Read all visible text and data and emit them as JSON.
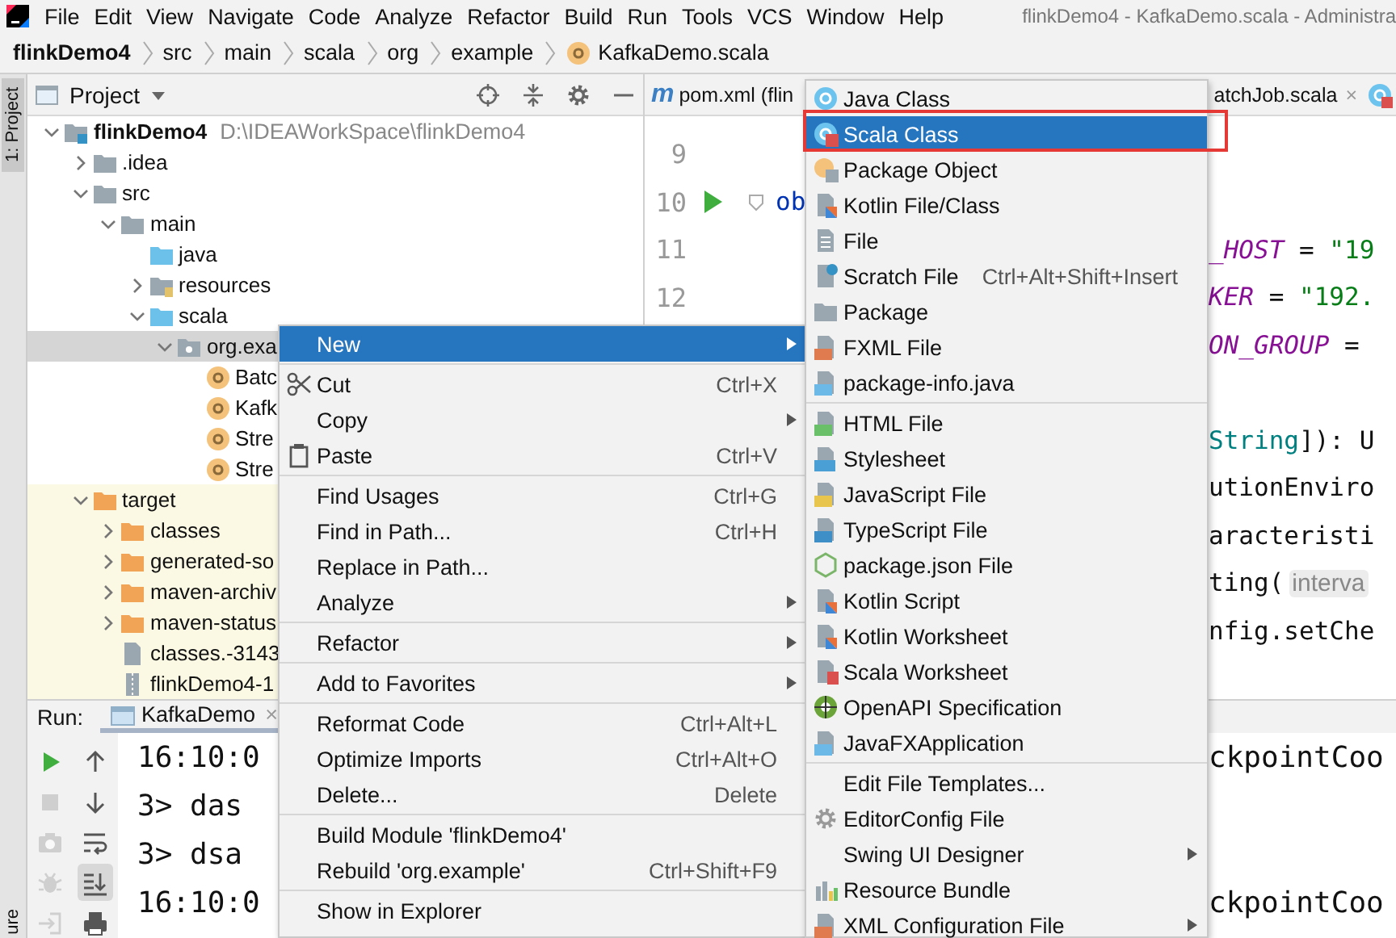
{
  "window": {
    "title": "flinkDemo4 - KafkaDemo.scala - Administra"
  },
  "menu_bar": [
    "File",
    "Edit",
    "View",
    "Navigate",
    "Code",
    "Analyze",
    "Refactor",
    "Build",
    "Run",
    "Tools",
    "VCS",
    "Window",
    "Help"
  ],
  "breadcrumbs": [
    {
      "label": "flinkDemo4",
      "kind": "project"
    },
    {
      "label": "src",
      "kind": "folder"
    },
    {
      "label": "main",
      "kind": "folder"
    },
    {
      "label": "scala",
      "kind": "folder"
    },
    {
      "label": "org",
      "kind": "folder"
    },
    {
      "label": "example",
      "kind": "folder"
    },
    {
      "label": "KafkaDemo.scala",
      "kind": "file"
    }
  ],
  "tool_stripe": [
    "1: Project",
    "ure"
  ],
  "project_panel": {
    "title": "Project",
    "tree": [
      {
        "label": "flinkDemo4",
        "path": "D:\\IDEAWorkSpace\\flinkDemo4",
        "kind": "module",
        "expanded": true,
        "selected": false,
        "children": [
          {
            "label": ".idea",
            "kind": "folder",
            "expanded": false,
            "selected": false
          },
          {
            "label": "src",
            "kind": "folder",
            "expanded": true,
            "selected": false,
            "children": [
              {
                "label": "main",
                "kind": "folder",
                "expanded": true,
                "selected": false,
                "children": [
                  {
                    "label": "java",
                    "kind": "source-folder",
                    "selected": false
                  },
                  {
                    "label": "resources",
                    "kind": "resource-folder",
                    "expanded": false,
                    "selected": false
                  },
                  {
                    "label": "scala",
                    "kind": "source-folder",
                    "expanded": true,
                    "selected": false,
                    "children": [
                      {
                        "label": "org.exa",
                        "kind": "package",
                        "expanded": true,
                        "selected": true,
                        "children": [
                          {
                            "label": "Batc",
                            "kind": "scala-object",
                            "selected": false
                          },
                          {
                            "label": "Kafk",
                            "kind": "scala-object",
                            "selected": false
                          },
                          {
                            "label": "Stre",
                            "kind": "scala-object",
                            "selected": false
                          },
                          {
                            "label": "Stre",
                            "kind": "scala-object",
                            "selected": false
                          }
                        ]
                      }
                    ]
                  }
                ]
              }
            ]
          },
          {
            "label": "target",
            "kind": "excluded-folder",
            "expanded": true,
            "selected": false,
            "children": [
              {
                "label": "classes",
                "kind": "excluded-folder",
                "expanded": false,
                "selected": false
              },
              {
                "label": "generated-so",
                "kind": "excluded-folder",
                "expanded": false,
                "selected": false
              },
              {
                "label": "maven-archiv",
                "kind": "excluded-folder",
                "expanded": false,
                "selected": false
              },
              {
                "label": "maven-status",
                "kind": "excluded-folder",
                "expanded": false,
                "selected": false
              },
              {
                "label": "classes.-3143",
                "kind": "file",
                "selected": false
              },
              {
                "label": "flinkDemo4-1",
                "kind": "archive",
                "selected": false
              }
            ]
          }
        ]
      }
    ]
  },
  "editor": {
    "tabs": [
      {
        "glyph": "m",
        "label": "pom.xml (flin",
        "selected": false
      },
      {
        "label": "atchJob.scala",
        "close": "×",
        "selected": false
      }
    ],
    "lines": [
      {
        "number": "9",
        "kind": "plain"
      },
      {
        "number": "10",
        "kind": "runnable",
        "left": [
          {
            "text": "ob",
            "kind": "keyword"
          }
        ]
      },
      {
        "number": "11",
        "kind": "plain",
        "right": [
          {
            "text": "_HOST",
            "kind": "constant"
          },
          {
            "text": " = ",
            "kind": "plain"
          },
          {
            "text": "\"19",
            "kind": "string"
          }
        ]
      },
      {
        "number": "12",
        "kind": "plain",
        "right": [
          {
            "text": "KER",
            "kind": "constant"
          },
          {
            "text": " = ",
            "kind": "plain"
          },
          {
            "text": "\"192.",
            "kind": "string"
          }
        ]
      },
      {
        "kind": "plain",
        "right": [
          {
            "text": "ON_GROUP",
            "kind": "constant"
          },
          {
            "text": " =",
            "kind": "plain"
          }
        ]
      },
      {
        "kind": "plain"
      },
      {
        "kind": "plain",
        "right": [
          {
            "text": "String",
            "kind": "type"
          },
          {
            "text": "]): U",
            "kind": "plain"
          }
        ]
      },
      {
        "kind": "plain",
        "right": [
          {
            "text": "utionEnviro",
            "kind": "plain"
          }
        ]
      },
      {
        "kind": "plain",
        "right": [
          {
            "text": "aracteristi",
            "kind": "plain"
          }
        ]
      },
      {
        "kind": "plain",
        "right": [
          {
            "text": "ting(",
            "kind": "plain"
          },
          {
            "text": "interva",
            "kind": "hint"
          }
        ]
      },
      {
        "kind": "plain",
        "right": [
          {
            "text": "nfig.setChe",
            "kind": "plain"
          }
        ]
      }
    ]
  },
  "run_panel": {
    "label": "Run:",
    "tabs": [
      {
        "label": "KafkaDemo",
        "close": "×",
        "selected": true
      }
    ],
    "toolbar": [
      {
        "kind": "rerun",
        "disabled": false
      },
      {
        "kind": "stop",
        "disabled": true
      },
      {
        "kind": "camera",
        "disabled": true
      },
      {
        "kind": "bug",
        "disabled": true
      },
      {
        "kind": "exit",
        "disabled": true
      }
    ],
    "toolbar_2": [
      {
        "kind": "up",
        "on": false
      },
      {
        "kind": "down",
        "on": false
      },
      {
        "kind": "wrap",
        "on": false
      },
      {
        "kind": "scroll-end",
        "on": true
      },
      {
        "kind": "print",
        "on": false
      }
    ],
    "console": [
      {
        "text": "16:10:0",
        "tail": "ckpointCoo"
      },
      {
        "text": "3> das"
      },
      {
        "text": "3> dsa"
      },
      {
        "text": "16:10:0",
        "tail": "ckpointCoo"
      }
    ]
  },
  "context_menu": {
    "groups": [
      [
        {
          "label": "New",
          "kind": "plain",
          "has_submenu": true,
          "selected": true
        }
      ],
      [
        {
          "label": "Cut",
          "kind": "cut",
          "shortcut": "Ctrl+X",
          "has_submenu": false,
          "selected": false
        },
        {
          "label": "Copy",
          "kind": "plain",
          "has_submenu": true,
          "selected": false
        },
        {
          "label": "Paste",
          "kind": "paste",
          "shortcut": "Ctrl+V",
          "has_submenu": false,
          "selected": false
        }
      ],
      [
        {
          "label": "Find Usages",
          "kind": "plain",
          "shortcut": "Ctrl+G",
          "has_submenu": false,
          "selected": false
        },
        {
          "label": "Find in Path...",
          "kind": "plain",
          "shortcut": "Ctrl+H",
          "has_submenu": false,
          "selected": false
        },
        {
          "label": "Replace in Path...",
          "kind": "plain",
          "has_submenu": false,
          "selected": false
        },
        {
          "label": "Analyze",
          "kind": "plain",
          "has_submenu": true,
          "selected": false
        }
      ],
      [
        {
          "label": "Refactor",
          "kind": "plain",
          "has_submenu": true,
          "selected": false
        }
      ],
      [
        {
          "label": "Add to Favorites",
          "kind": "plain",
          "has_submenu": true,
          "selected": false
        }
      ],
      [
        {
          "label": "Reformat Code",
          "kind": "plain",
          "shortcut": "Ctrl+Alt+L",
          "has_submenu": false,
          "selected": false
        },
        {
          "label": "Optimize Imports",
          "kind": "plain",
          "shortcut": "Ctrl+Alt+O",
          "has_submenu": false,
          "selected": false
        },
        {
          "label": "Delete...",
          "kind": "plain",
          "shortcut": "Delete",
          "has_submenu": false,
          "selected": false
        }
      ],
      [
        {
          "label": "Build Module 'flinkDemo4'",
          "kind": "plain",
          "has_submenu": false,
          "selected": false
        },
        {
          "label": "Rebuild 'org.example'",
          "kind": "plain",
          "shortcut": "Ctrl+Shift+F9",
          "has_submenu": false,
          "selected": false
        }
      ],
      [
        {
          "label": "Show in Explorer",
          "kind": "plain",
          "has_submenu": false,
          "selected": false
        }
      ]
    ]
  },
  "new_submenu": {
    "groups": [
      [
        {
          "label": "Java Class",
          "kind": "java-class",
          "has_submenu": false,
          "selected": false,
          "annotated": false
        },
        {
          "label": "Scala Class",
          "kind": "scala-class",
          "has_submenu": false,
          "selected": true,
          "annotated": true
        },
        {
          "label": "Package Object",
          "kind": "package-object",
          "has_submenu": false,
          "selected": false,
          "annotated": false
        },
        {
          "label": "Kotlin File/Class",
          "kind": "kotlin",
          "has_submenu": false,
          "selected": false,
          "annotated": false
        },
        {
          "label": "File",
          "kind": "file",
          "has_submenu": false,
          "selected": false,
          "annotated": false
        },
        {
          "label": "Scratch File",
          "kind": "scratch",
          "shortcut": "Ctrl+Alt+Shift+Insert",
          "has_submenu": false,
          "selected": false,
          "annotated": false
        },
        {
          "label": "Package",
          "kind": "package",
          "has_submenu": false,
          "selected": false,
          "annotated": false
        },
        {
          "label": "FXML File",
          "kind": "fxml",
          "has_submenu": false,
          "selected": false,
          "annotated": false
        },
        {
          "label": "package-info.java",
          "kind": "java-file",
          "has_submenu": false,
          "selected": false,
          "annotated": false
        }
      ],
      [
        {
          "label": "HTML File",
          "kind": "html",
          "has_submenu": false,
          "selected": false,
          "annotated": false
        },
        {
          "label": "Stylesheet",
          "kind": "css",
          "has_submenu": false,
          "selected": false,
          "annotated": false
        },
        {
          "label": "JavaScript File",
          "kind": "js",
          "has_submenu": false,
          "selected": false,
          "annotated": false
        },
        {
          "label": "TypeScript File",
          "kind": "ts",
          "has_submenu": false,
          "selected": false,
          "annotated": false
        },
        {
          "label": "package.json File",
          "kind": "npm",
          "has_submenu": false,
          "selected": false,
          "annotated": false
        },
        {
          "label": "Kotlin Script",
          "kind": "kotlin",
          "has_submenu": false,
          "selected": false,
          "annotated": false
        },
        {
          "label": "Kotlin Worksheet",
          "kind": "kotlin",
          "has_submenu": false,
          "selected": false,
          "annotated": false
        },
        {
          "label": "Scala Worksheet",
          "kind": "scala-worksheet",
          "has_submenu": false,
          "selected": false,
          "annotated": false
        },
        {
          "label": "OpenAPI Specification",
          "kind": "openapi",
          "has_submenu": false,
          "selected": false,
          "annotated": false
        },
        {
          "label": "JavaFXApplication",
          "kind": "java-file",
          "has_submenu": false,
          "selected": false,
          "annotated": false
        }
      ],
      [
        {
          "label": "Edit File Templates...",
          "kind": "none",
          "has_submenu": false,
          "selected": false,
          "annotated": false
        },
        {
          "label": "EditorConfig File",
          "kind": "gear",
          "has_submenu": false,
          "selected": false,
          "annotated": false
        },
        {
          "label": "Swing UI Designer",
          "kind": "none",
          "has_submenu": true,
          "selected": false,
          "annotated": false
        },
        {
          "label": "Resource Bundle",
          "kind": "bundle",
          "has_submenu": false,
          "selected": false,
          "annotated": false
        },
        {
          "label": "XML Configuration File",
          "kind": "fxml",
          "has_submenu": true,
          "selected": false,
          "annotated": false
        }
      ]
    ]
  }
}
